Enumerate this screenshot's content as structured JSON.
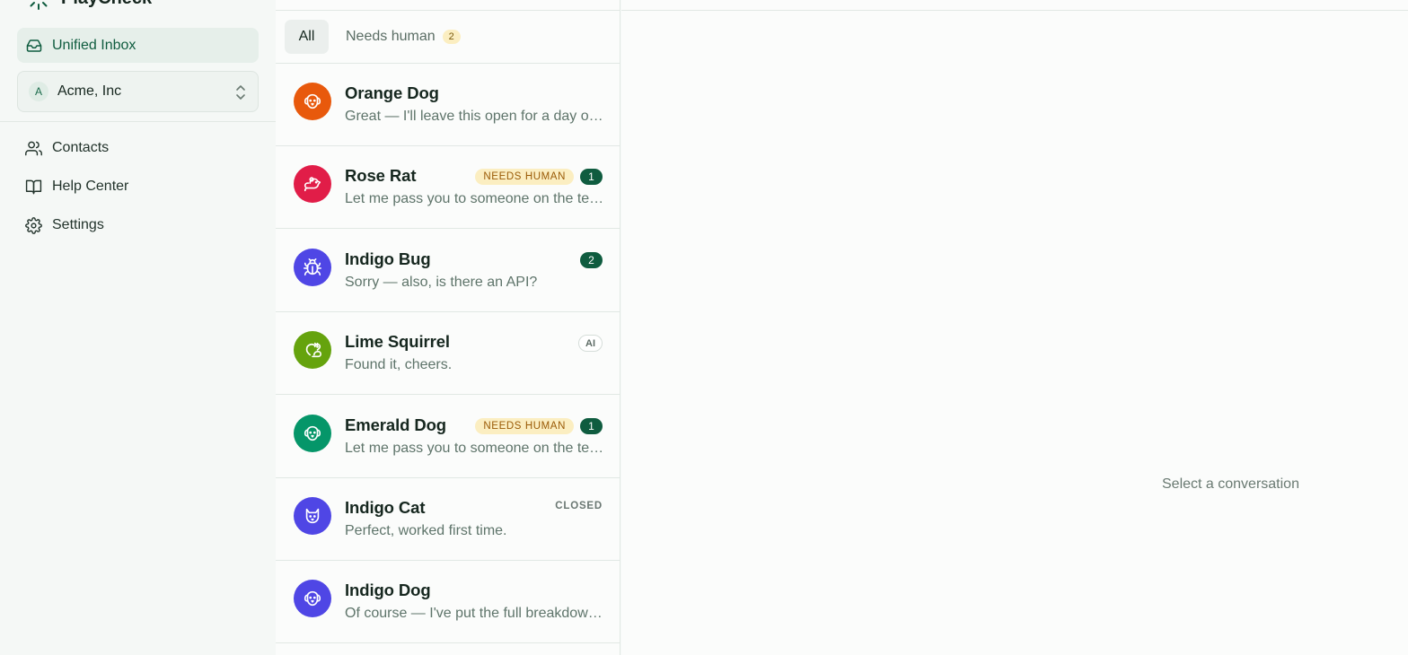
{
  "app": {
    "name": "PlayCheck",
    "accent_color": "#0f5c3f"
  },
  "sidebar": {
    "active_item": {
      "label": "Unified Inbox",
      "icon": "inbox-icon"
    },
    "org": {
      "initial": "A",
      "name": "Acme, Inc"
    },
    "items": [
      {
        "label": "Contacts",
        "icon": "users-icon"
      },
      {
        "label": "Help Center",
        "icon": "book-icon"
      },
      {
        "label": "Settings",
        "icon": "gear-icon"
      }
    ]
  },
  "list": {
    "tabs": [
      {
        "label": "All",
        "active": true
      },
      {
        "label": "Needs human",
        "count": "2"
      }
    ],
    "conversations": [
      {
        "name": "Orange Dog",
        "preview": "Great — I'll leave this open for a day or two in case anything else comes up.",
        "avatar_color": "#e8590c",
        "icon": "dog-icon",
        "needs_human": "",
        "count": "",
        "ai": "",
        "status": ""
      },
      {
        "name": "Rose Rat",
        "preview": "Let me pass you to someone on the team who can help with that.",
        "avatar_color": "#e11d48",
        "icon": "rat-icon",
        "needs_human": "NEEDS HUMAN",
        "count": "1",
        "ai": "",
        "status": ""
      },
      {
        "name": "Indigo Bug",
        "preview": "Sorry — also, is there an API?",
        "avatar_color": "#4f46e5",
        "icon": "bug-icon",
        "needs_human": "",
        "count": "2",
        "ai": "",
        "status": ""
      },
      {
        "name": "Lime Squirrel",
        "preview": "Found it, cheers.",
        "avatar_color": "#65a30d",
        "icon": "squirrel-icon",
        "needs_human": "",
        "count": "",
        "ai": "AI",
        "status": ""
      },
      {
        "name": "Emerald Dog",
        "preview": "Let me pass you to someone on the team who can help with that.",
        "avatar_color": "#059669",
        "icon": "dog-icon",
        "needs_human": "NEEDS HUMAN",
        "count": "1",
        "ai": "",
        "status": ""
      },
      {
        "name": "Indigo Cat",
        "preview": "Perfect, worked first time.",
        "avatar_color": "#4f46e5",
        "icon": "cat-icon",
        "needs_human": "",
        "count": "",
        "ai": "",
        "status": "CLOSED"
      },
      {
        "name": "Indigo Dog",
        "preview": "Of course — I've put the full breakdown below so you can check each item.",
        "avatar_color": "#4f46e5",
        "icon": "dog-icon",
        "needs_human": "",
        "count": "",
        "ai": "",
        "status": ""
      }
    ]
  },
  "main": {
    "empty_text": "Select a conversation"
  }
}
